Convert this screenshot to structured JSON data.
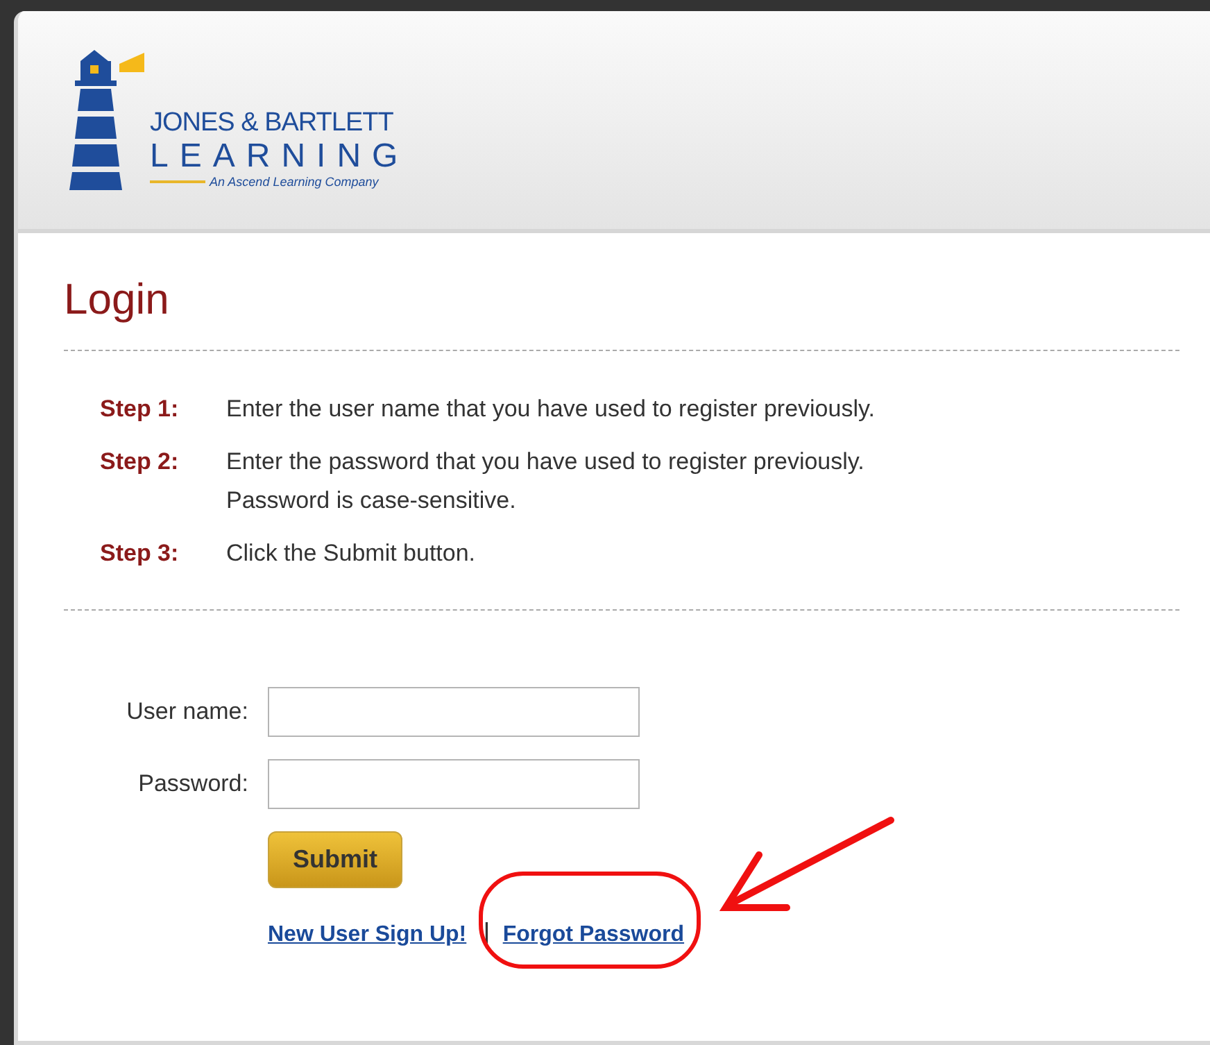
{
  "logo": {
    "name_line": "JONES & BARTLETT",
    "sub_line": "LEARNING",
    "tagline": "An Ascend Learning Company"
  },
  "title": "Login",
  "steps": [
    {
      "label": "Step 1:",
      "text": "Enter the user name that you have used to register previously."
    },
    {
      "label": "Step 2:",
      "text": "Enter the password that you have used to register previously. Password is case-sensitive."
    },
    {
      "label": "Step 3:",
      "text": "Click the Submit button."
    }
  ],
  "fields": [
    {
      "label": "User name:"
    },
    {
      "label": "Password:"
    }
  ],
  "submit": "Submit",
  "links": [
    {
      "label": "New User Sign Up!",
      "highlighted": false
    },
    {
      "label": "Forgot Password",
      "highlighted": true
    }
  ],
  "separator": "|"
}
